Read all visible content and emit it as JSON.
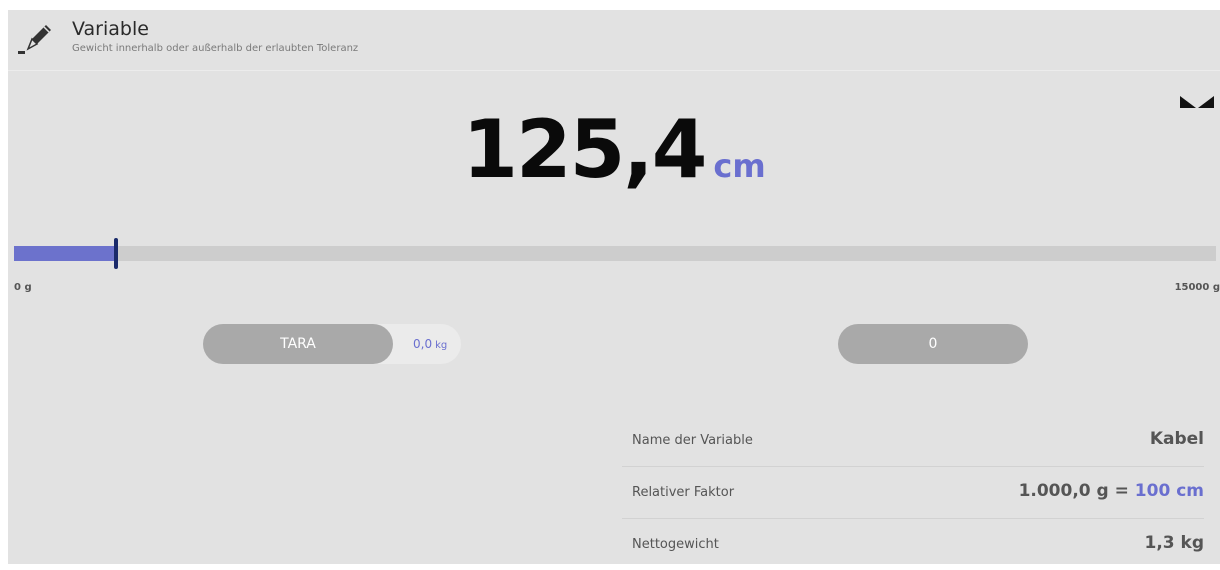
{
  "header": {
    "title": "Variable",
    "subtitle": "Gewicht innerhalb oder außerhalb der erlaubten Toleranz",
    "icon": "pencil-icon"
  },
  "display": {
    "value": "125,4",
    "unit": "cm"
  },
  "progress": {
    "min_label": "0 g",
    "max_label": "15000 g",
    "fill_fraction": 0.085
  },
  "tara": {
    "label": "TARA",
    "value": "0,0",
    "unit": "kg"
  },
  "zero_button": {
    "label": "0"
  },
  "info": {
    "rows": [
      {
        "label": "Name der Variable",
        "value": "Kabel"
      },
      {
        "label": "Relativer Faktor",
        "value_prefix": "1.000,0 g = ",
        "value_accent": "100 cm"
      },
      {
        "label": "Nettogewicht",
        "value": "1,3 kg"
      }
    ]
  },
  "colors": {
    "accent": "#6a6fcf",
    "marker": "#1a2a6a",
    "button_bg": "#a9a9a9",
    "panel_bg": "#e2e2e2"
  }
}
